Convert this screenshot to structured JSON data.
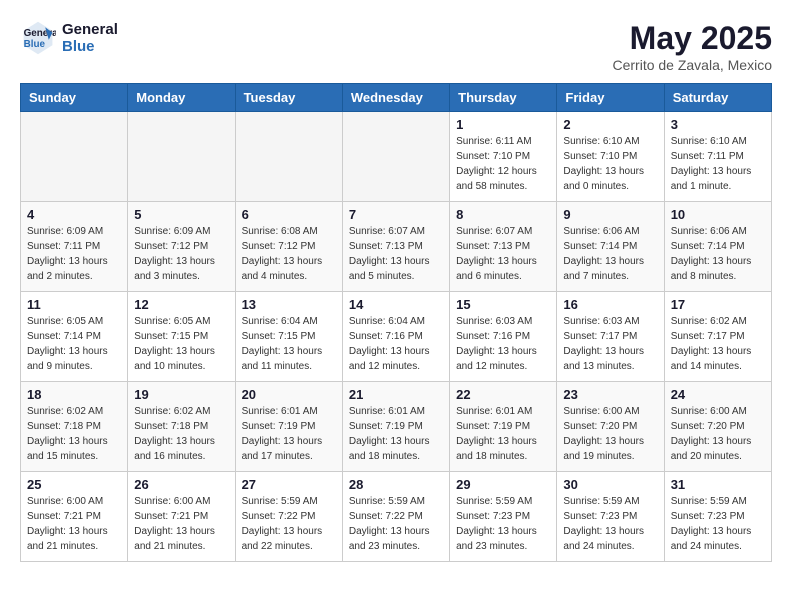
{
  "header": {
    "logo_line1": "General",
    "logo_line2": "Blue",
    "month_title": "May 2025",
    "location": "Cerrito de Zavala, Mexico"
  },
  "weekdays": [
    "Sunday",
    "Monday",
    "Tuesday",
    "Wednesday",
    "Thursday",
    "Friday",
    "Saturday"
  ],
  "weeks": [
    [
      null,
      null,
      null,
      null,
      {
        "day": "1",
        "sunrise": "6:11 AM",
        "sunset": "7:10 PM",
        "daylight": "12 hours and 58 minutes."
      },
      {
        "day": "2",
        "sunrise": "6:10 AM",
        "sunset": "7:10 PM",
        "daylight": "13 hours and 0 minutes."
      },
      {
        "day": "3",
        "sunrise": "6:10 AM",
        "sunset": "7:11 PM",
        "daylight": "13 hours and 1 minute."
      }
    ],
    [
      {
        "day": "4",
        "sunrise": "6:09 AM",
        "sunset": "7:11 PM",
        "daylight": "13 hours and 2 minutes."
      },
      {
        "day": "5",
        "sunrise": "6:09 AM",
        "sunset": "7:12 PM",
        "daylight": "13 hours and 3 minutes."
      },
      {
        "day": "6",
        "sunrise": "6:08 AM",
        "sunset": "7:12 PM",
        "daylight": "13 hours and 4 minutes."
      },
      {
        "day": "7",
        "sunrise": "6:07 AM",
        "sunset": "7:13 PM",
        "daylight": "13 hours and 5 minutes."
      },
      {
        "day": "8",
        "sunrise": "6:07 AM",
        "sunset": "7:13 PM",
        "daylight": "13 hours and 6 minutes."
      },
      {
        "day": "9",
        "sunrise": "6:06 AM",
        "sunset": "7:14 PM",
        "daylight": "13 hours and 7 minutes."
      },
      {
        "day": "10",
        "sunrise": "6:06 AM",
        "sunset": "7:14 PM",
        "daylight": "13 hours and 8 minutes."
      }
    ],
    [
      {
        "day": "11",
        "sunrise": "6:05 AM",
        "sunset": "7:14 PM",
        "daylight": "13 hours and 9 minutes."
      },
      {
        "day": "12",
        "sunrise": "6:05 AM",
        "sunset": "7:15 PM",
        "daylight": "13 hours and 10 minutes."
      },
      {
        "day": "13",
        "sunrise": "6:04 AM",
        "sunset": "7:15 PM",
        "daylight": "13 hours and 11 minutes."
      },
      {
        "day": "14",
        "sunrise": "6:04 AM",
        "sunset": "7:16 PM",
        "daylight": "13 hours and 12 minutes."
      },
      {
        "day": "15",
        "sunrise": "6:03 AM",
        "sunset": "7:16 PM",
        "daylight": "13 hours and 12 minutes."
      },
      {
        "day": "16",
        "sunrise": "6:03 AM",
        "sunset": "7:17 PM",
        "daylight": "13 hours and 13 minutes."
      },
      {
        "day": "17",
        "sunrise": "6:02 AM",
        "sunset": "7:17 PM",
        "daylight": "13 hours and 14 minutes."
      }
    ],
    [
      {
        "day": "18",
        "sunrise": "6:02 AM",
        "sunset": "7:18 PM",
        "daylight": "13 hours and 15 minutes."
      },
      {
        "day": "19",
        "sunrise": "6:02 AM",
        "sunset": "7:18 PM",
        "daylight": "13 hours and 16 minutes."
      },
      {
        "day": "20",
        "sunrise": "6:01 AM",
        "sunset": "7:19 PM",
        "daylight": "13 hours and 17 minutes."
      },
      {
        "day": "21",
        "sunrise": "6:01 AM",
        "sunset": "7:19 PM",
        "daylight": "13 hours and 18 minutes."
      },
      {
        "day": "22",
        "sunrise": "6:01 AM",
        "sunset": "7:19 PM",
        "daylight": "13 hours and 18 minutes."
      },
      {
        "day": "23",
        "sunrise": "6:00 AM",
        "sunset": "7:20 PM",
        "daylight": "13 hours and 19 minutes."
      },
      {
        "day": "24",
        "sunrise": "6:00 AM",
        "sunset": "7:20 PM",
        "daylight": "13 hours and 20 minutes."
      }
    ],
    [
      {
        "day": "25",
        "sunrise": "6:00 AM",
        "sunset": "7:21 PM",
        "daylight": "13 hours and 21 minutes."
      },
      {
        "day": "26",
        "sunrise": "6:00 AM",
        "sunset": "7:21 PM",
        "daylight": "13 hours and 21 minutes."
      },
      {
        "day": "27",
        "sunrise": "5:59 AM",
        "sunset": "7:22 PM",
        "daylight": "13 hours and 22 minutes."
      },
      {
        "day": "28",
        "sunrise": "5:59 AM",
        "sunset": "7:22 PM",
        "daylight": "13 hours and 23 minutes."
      },
      {
        "day": "29",
        "sunrise": "5:59 AM",
        "sunset": "7:23 PM",
        "daylight": "13 hours and 23 minutes."
      },
      {
        "day": "30",
        "sunrise": "5:59 AM",
        "sunset": "7:23 PM",
        "daylight": "13 hours and 24 minutes."
      },
      {
        "day": "31",
        "sunrise": "5:59 AM",
        "sunset": "7:23 PM",
        "daylight": "13 hours and 24 minutes."
      }
    ]
  ],
  "labels": {
    "sunrise": "Sunrise: ",
    "sunset": "Sunset: ",
    "daylight": "Daylight: "
  }
}
